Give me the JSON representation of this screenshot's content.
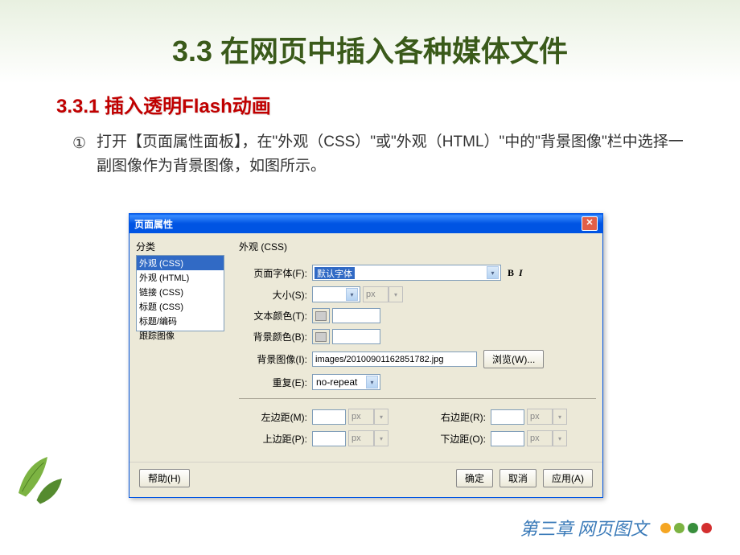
{
  "title": "3.3 在网页中插入各种媒体文件",
  "subtitle": "3.3.1 插入透明Flash动画",
  "listMarker": "①",
  "bodyText": "打开【页面属性面板】，在\"外观（CSS）\"或\"外观（HTML）\"中的\"背景图像\"栏中选择一副图像作为背景图像，如图所示。",
  "dialog": {
    "title": "页面属性",
    "categoryLabel": "分类",
    "panelTitle": "外观 (CSS)",
    "categories": [
      {
        "label": "外观 (CSS)",
        "selected": true
      },
      {
        "label": "外观 (HTML)",
        "selected": false
      },
      {
        "label": "链接 (CSS)",
        "selected": false
      },
      {
        "label": "标题 (CSS)",
        "selected": false
      },
      {
        "label": "标题/编码",
        "selected": false
      },
      {
        "label": "跟踪图像",
        "selected": false
      }
    ],
    "fields": {
      "fontLabel": "页面字体(F):",
      "fontValue": "默认字体",
      "sizeLabel": "大小(S):",
      "sizeUnit": "px",
      "textColorLabel": "文本颜色(T):",
      "bgColorLabel": "背景颜色(B):",
      "bgImageLabel": "背景图像(I):",
      "bgImageValue": "images/20100901162851782.jpg",
      "browseBtn": "浏览(W)...",
      "repeatLabel": "重复(E):",
      "repeatValue": "no-repeat",
      "leftMarginLabel": "左边距(M):",
      "rightMarginLabel": "右边距(R):",
      "topMarginLabel": "上边距(P):",
      "bottomMarginLabel": "下边距(O):",
      "marginUnit": "px"
    },
    "buttons": {
      "help": "帮助(H)",
      "ok": "确定",
      "cancel": "取消",
      "apply": "应用(A)"
    }
  },
  "footer": "第三章 网页图文",
  "dotColors": [
    "#f5a623",
    "#7cb342",
    "#388e3c",
    "#d32f2f"
  ]
}
